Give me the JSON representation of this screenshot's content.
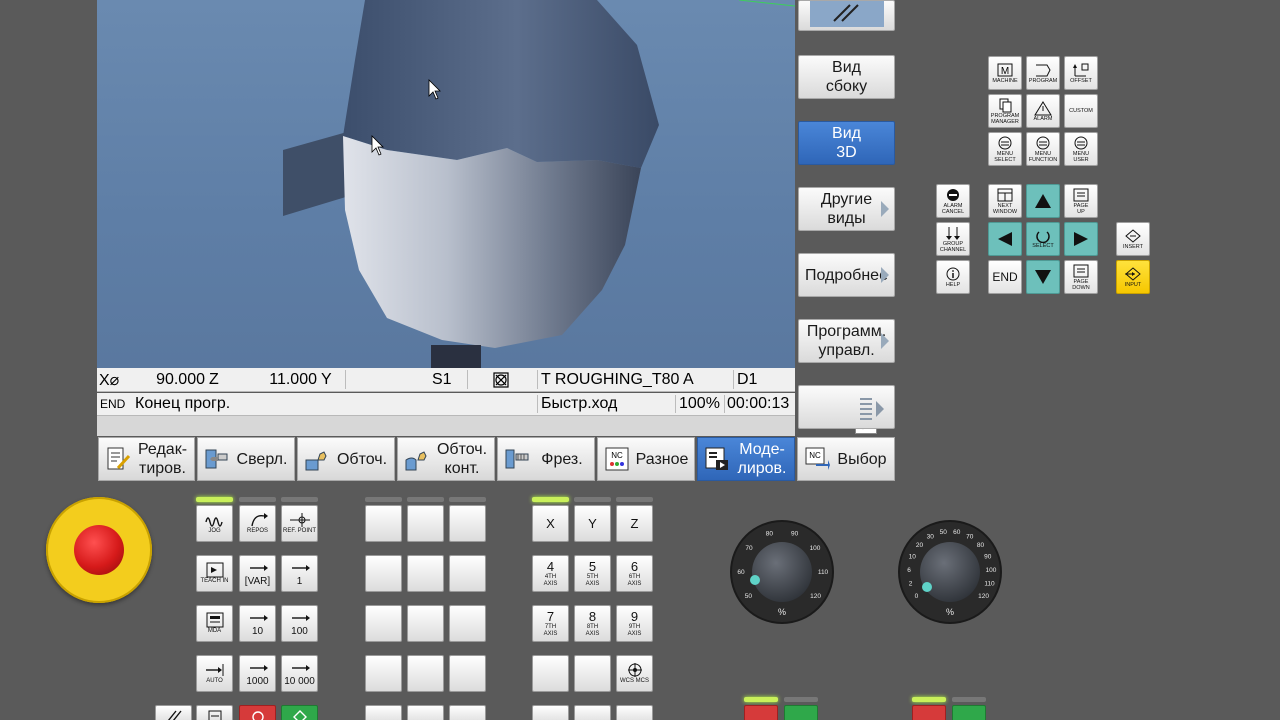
{
  "status": {
    "row1": {
      "axis1_label": "X⌀",
      "axis1_value": "90.000",
      "axis2_label": "Z",
      "axis2_value": "11.000",
      "axis3_label": "Y",
      "spindle": "S1",
      "tool": "T ROUGHING_T80 A",
      "d_number": "D1"
    },
    "row2": {
      "mode": "END",
      "message": "Конец прогр.",
      "feed_mode": "Быстр.ход",
      "override": "100%",
      "time": "00:00:13"
    },
    "more": ">"
  },
  "vertical_softkeys": [
    {
      "label": ""
    },
    {
      "label": "Вид\nсбоку"
    },
    {
      "label": "Вид\n3D"
    },
    {
      "label": "Другие\nвиды"
    },
    {
      "label": "Подробнее"
    },
    {
      "label": "Программ.\nуправл."
    },
    {
      "label": ""
    }
  ],
  "horizontal_softkeys": [
    {
      "label": "Редак-\nтиров."
    },
    {
      "label": "Сверл."
    },
    {
      "label": "Обточ."
    },
    {
      "label": "Обточ.\nконт."
    },
    {
      "label": "Фрез."
    },
    {
      "label": "Разное",
      "icon_text": "NC"
    },
    {
      "label": "Моде-\nлиров."
    },
    {
      "label": "Выбор",
      "icon_text": "NC"
    }
  ],
  "keypad": {
    "machine": "MACHINE",
    "program": "PROGRAM",
    "offset": "OFFSET",
    "program_manager": "PROGRAM\nMANAGER",
    "alarm": "ALARM",
    "custom": "CUSTOM",
    "menu_select": "MENU\nSELECT",
    "menu_function": "MENU\nFUNCTION",
    "menu_user": "MENU\nUSER",
    "alarm_cancel": "ALARM\nCANCEL",
    "next_window": "NEXT\nWINDOW",
    "page_up": "PAGE\nUP",
    "group_channel": "GROUP\nCHANNEL",
    "select": "SELECT",
    "insert": "INSERT",
    "help": "HELP",
    "end": "END",
    "page_down": "PAGE\nDOWN",
    "input": "INPUT",
    "machine_letter": "M"
  },
  "machine_panel": {
    "jog": "JOG",
    "repos": "REPOS",
    "ref_point": "REF. POINT",
    "teach_in": "TEACH IN",
    "var": "[VAR]",
    "inc_1": "1",
    "mda": "MDA",
    "inc_10": "10",
    "inc_100": "100",
    "auto": "AUTO",
    "inc_1000": "1000",
    "inc_10000": "10 000",
    "axis_x": "X",
    "axis_y": "Y",
    "axis_z": "Z",
    "axis4": "4",
    "axis4_sub": "4TH\nAXIS",
    "axis5": "5",
    "axis5_sub": "5TH\nAXIS",
    "axis6": "6",
    "axis6_sub": "6TH\nAXIS",
    "axis7": "7",
    "axis7_sub": "7TH\nAXIS",
    "axis8": "8",
    "axis8_sub": "8TH\nAXIS",
    "axis9": "9",
    "axis9_sub": "9TH\nAXIS",
    "wcs_mcs": "WCS MCS"
  },
  "dial_spindle": {
    "ticks": [
      "50",
      "60",
      "70",
      "80",
      "90",
      "100",
      "110",
      "120"
    ],
    "label": "%"
  },
  "dial_feed": {
    "ticks": [
      "0",
      "2",
      "6",
      "10",
      "20",
      "30",
      "50",
      "60",
      "70",
      "80",
      "90",
      "100",
      "110",
      "120"
    ],
    "label": "%"
  },
  "colors": {
    "accent_blue": "#2f66b8",
    "nav_teal": "#6dc0bb",
    "input_yellow": "#f6c700",
    "estop_red": "#d61a1a",
    "estop_yellow": "#f3cd1d",
    "led_green": "#c9f05a"
  }
}
